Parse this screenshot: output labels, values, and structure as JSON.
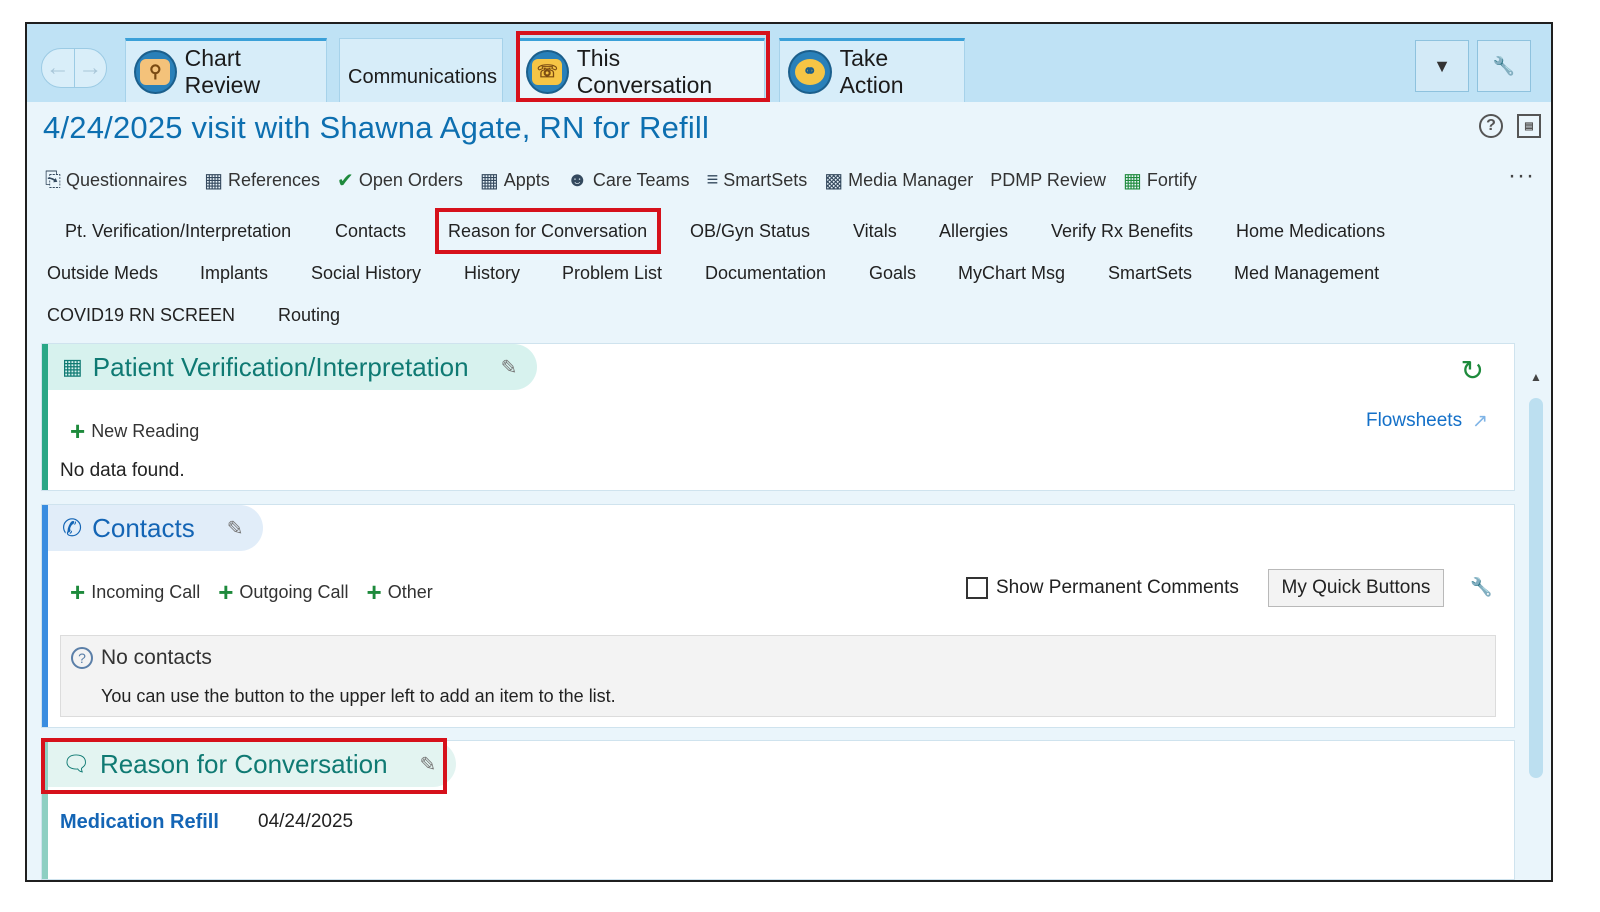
{
  "tabs": {
    "chart_review": "Chart Review",
    "communications": "Communications",
    "this_conversation": "This Conversation",
    "take_action": "Take Action"
  },
  "header": {
    "title": "4/24/2025 visit with Shawna Agate, RN for Refill"
  },
  "toolbar": {
    "items": [
      "Questionnaires",
      "References",
      "Open Orders",
      "Appts",
      "Care Teams",
      "SmartSets",
      "Media Manager",
      "PDMP Review",
      "Fortify"
    ],
    "more": "···"
  },
  "activities": {
    "row1": [
      "Pt. Verification/Interpretation",
      "Contacts",
      "Reason for Conversation",
      "OB/Gyn Status",
      "Vitals",
      "Allergies",
      "Verify Rx Benefits",
      "Home Medications"
    ],
    "row2": [
      "Outside Meds",
      "Implants",
      "Social History",
      "History",
      "Problem List",
      "Documentation",
      "Goals",
      "MyChart Msg",
      "SmartSets",
      "Med Management"
    ],
    "row3": [
      "COVID19 RN SCREEN",
      "Routing"
    ]
  },
  "verification": {
    "title": "Patient Verification/Interpretation",
    "new_reading": "New Reading",
    "flowsheets": "Flowsheets",
    "empty": "No data found."
  },
  "contacts": {
    "title": "Contacts",
    "incoming": "Incoming Call",
    "outgoing": "Outgoing Call",
    "other": "Other",
    "show_comments": "Show Permanent Comments",
    "quick_buttons": "My Quick Buttons",
    "no_contacts": "No contacts",
    "hint": "You can use the button to the upper left to add an item to the list."
  },
  "reason": {
    "title": "Reason for Conversation",
    "item": "Medication Refill",
    "date": "04/24/2025"
  },
  "colors": {
    "accent_blue": "#0d6fb0",
    "section_green": "#0f7a73",
    "highlight_red": "#d6111b"
  }
}
